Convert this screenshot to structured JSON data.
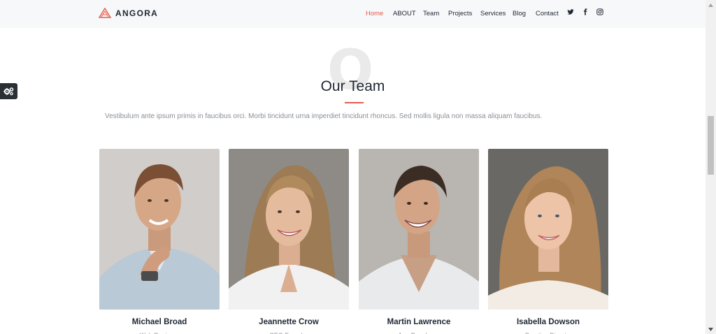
{
  "brand": {
    "name": "ANGORA",
    "accent": "#e45b4e"
  },
  "nav": {
    "items": [
      {
        "label": "Home",
        "active": true
      },
      {
        "label": "ABOUT",
        "active": false
      },
      {
        "label": "Team",
        "active": false
      },
      {
        "label": "Projects",
        "active": false
      },
      {
        "label": "Services",
        "active": false
      },
      {
        "label": "Blog",
        "active": false
      },
      {
        "label": "Contact",
        "active": false
      }
    ],
    "social": [
      "twitter-icon",
      "facebook-icon",
      "instagram-icon"
    ]
  },
  "section": {
    "bg_letter": "O",
    "title": "Our Team",
    "description": "Vestibulum ante ipsum primis in faucibus orci. Morbi tincidunt urna imperdiet tincidunt rhoncus. Sed mollis ligula non massa aliquam faucibus."
  },
  "team": [
    {
      "name": "Michael Broad",
      "role": "Web Designer"
    },
    {
      "name": "Jeannette Crow",
      "role": "CEO Founder"
    },
    {
      "name": "Martin Lawrence",
      "role": "App Developer"
    },
    {
      "name": "Isabella Dowson",
      "role": "Creative Director"
    }
  ]
}
